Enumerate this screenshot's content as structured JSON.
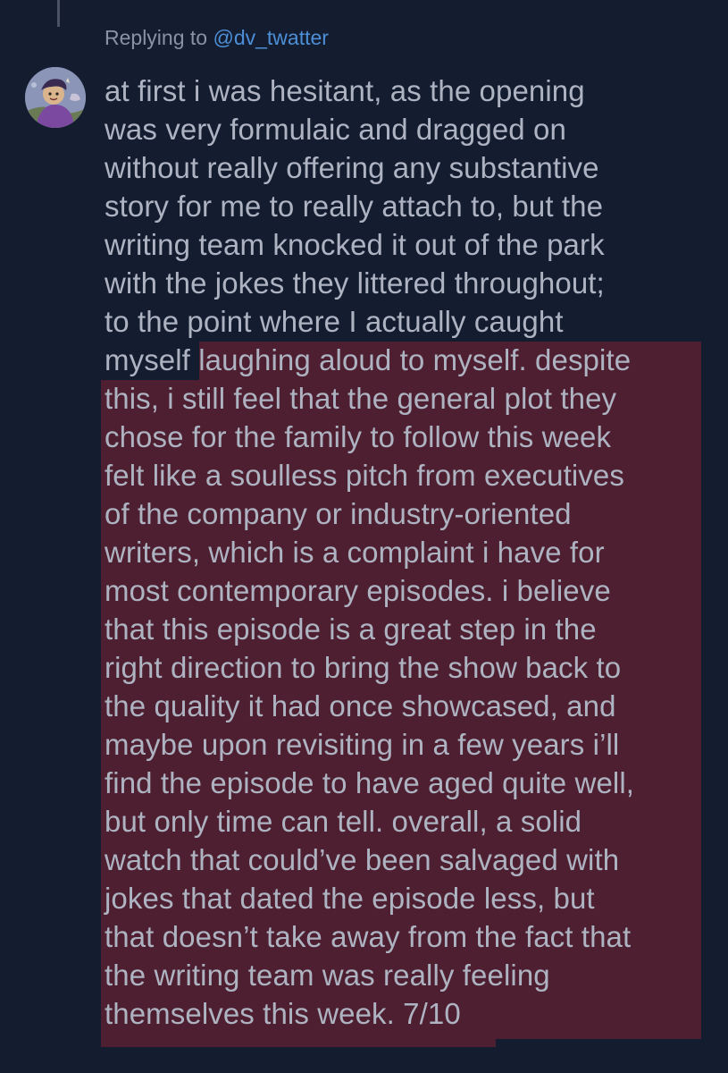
{
  "reply": {
    "prefix": "Replying to",
    "handle": "@dv_twatter"
  },
  "avatar": {
    "icon": "cartoon-character-avatar"
  },
  "tweet": {
    "lines": [
      "at first i was hesitant, as the opening",
      "was very formulaic and dragged on",
      "without really offering any substantive",
      "story for me to really attach to, but the",
      "writing team knocked it out of the park",
      "with the jokes they littered throughout;",
      "to the point where I actually caught"
    ],
    "line8_plain": "myself",
    "line8_highlighted": " laughing aloud to myself. despite",
    "highlighted_lines": [
      "this, i still feel that the general plot they",
      "chose for the family to follow this week",
      "felt like a soulless pitch from executives",
      "of the company or industry-oriented",
      "writers, which is a complaint i have for",
      "most contemporary episodes. i believe",
      "that this episode is a great step in the",
      "right direction to bring the show back to",
      "the quality it had once showcased, and",
      "maybe upon revisiting in a few years i’ll",
      "find the episode to have aged quite well,",
      "but only time can tell. overall, a solid",
      "watch that could’ve been salvaged with",
      "jokes that dated the episode less, but",
      "that doesn’t take away from the fact that",
      "the writing team was really feeling",
      "themselves this week. 7/10"
    ]
  },
  "colors": {
    "background": "#141c30",
    "text": "#aeb3c2",
    "link": "#4d8fd6",
    "highlight": "#4e1f30"
  }
}
